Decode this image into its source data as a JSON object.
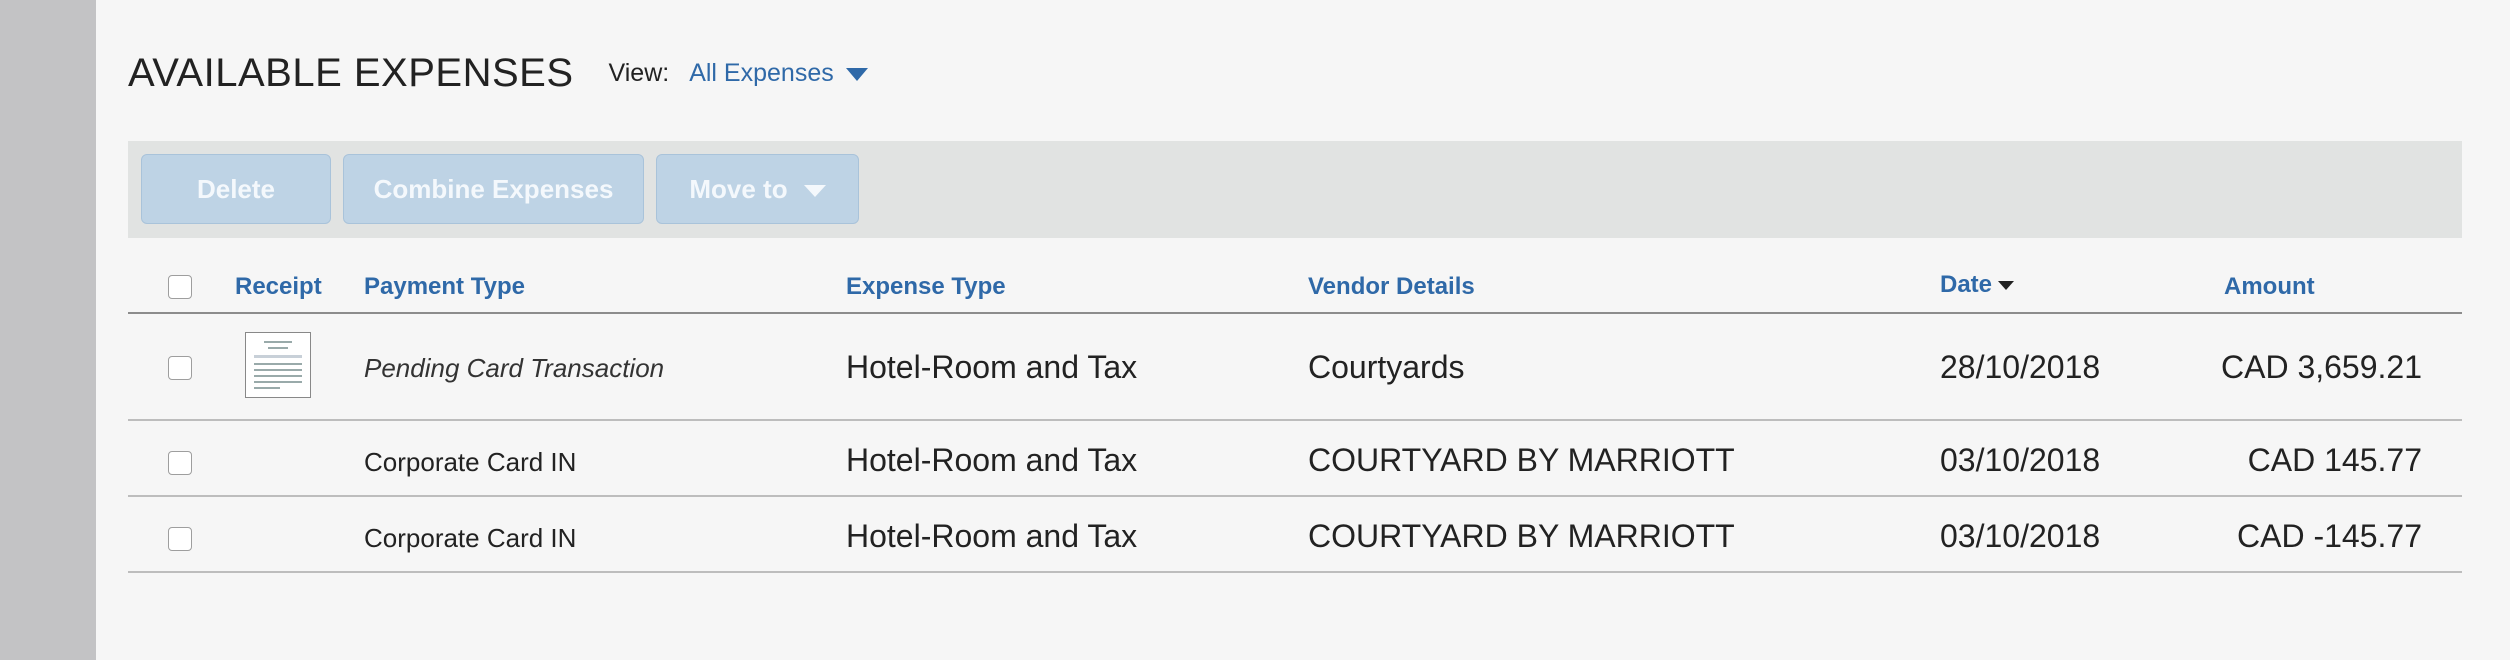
{
  "header": {
    "title": "AVAILABLE EXPENSES",
    "view_label": "View:",
    "view_value": "All Expenses"
  },
  "toolbar": {
    "delete_label": "Delete",
    "combine_label": "Combine Expenses",
    "move_label": "Move to"
  },
  "table": {
    "columns": {
      "receipt": "Receipt",
      "payment_type": "Payment Type",
      "expense_type": "Expense Type",
      "vendor": "Vendor Details",
      "date": "Date",
      "amount": "Amount"
    },
    "sort": {
      "column": "date",
      "direction": "descending"
    },
    "rows": [
      {
        "payment_type": "Pending Card Transaction",
        "payment_italic": true,
        "has_receipt": true,
        "receipt_icon": "receipt-thumbnail-icon",
        "expense_type": "Hotel-Room and Tax",
        "vendor": "Courtyards",
        "date": "28/10/2018",
        "amount": "CAD 3,659.21"
      },
      {
        "payment_type": "Corporate Card IN",
        "payment_italic": false,
        "has_receipt": false,
        "expense_type": "Hotel-Room and Tax",
        "vendor": "COURTYARD BY MARRIOTT",
        "date": "03/10/2018",
        "amount": "CAD 145.77"
      },
      {
        "payment_type": "Corporate Card IN",
        "payment_italic": false,
        "has_receipt": false,
        "expense_type": "Hotel-Room and Tax",
        "vendor": "COURTYARD BY MARRIOTT",
        "date": "03/10/2018",
        "amount": "CAD -145.77"
      }
    ]
  },
  "colors": {
    "link_blue": "#2f69a8",
    "toolbar_bg": "#e1e3e2",
    "button_disabled_bg": "#bed3e5"
  }
}
